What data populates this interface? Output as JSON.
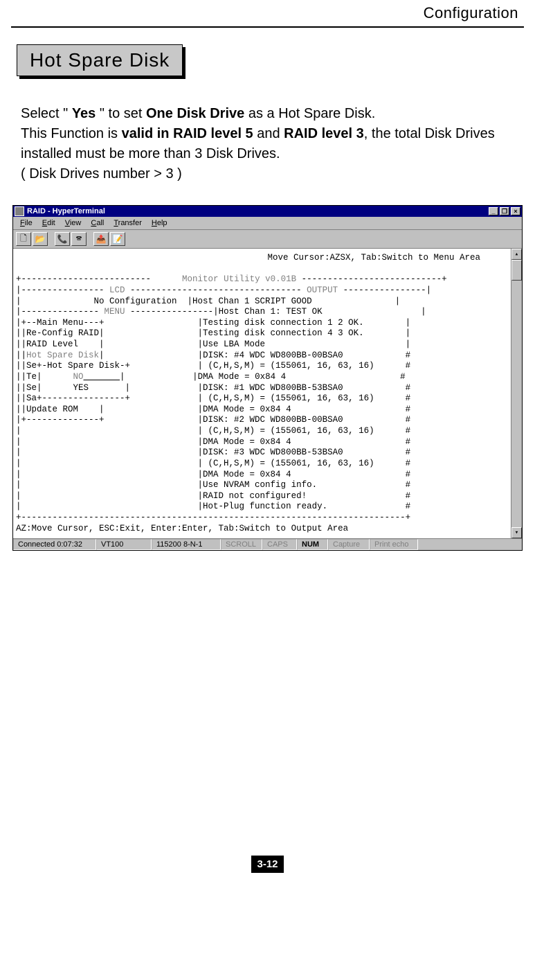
{
  "doc": {
    "header": "Configuration",
    "section_title": "Hot Spare Disk",
    "page_number": "3-12"
  },
  "body": {
    "p1_a": "Select \" ",
    "p1_yes": "Yes",
    "p1_b": " \" to set ",
    "p1_odd": "One Disk Drive",
    "p1_c": " as a Hot Spare Disk.",
    "p2_a": "This Function is ",
    "p2_v5": "valid in RAID level 5",
    "p2_b": " and ",
    "p2_v3": "RAID level 3",
    "p2_c": ", the total Disk Drives installed must be more than 3 Disk Drives.",
    "p3": "( Disk Drives number > 3 )"
  },
  "ht": {
    "title": "RAID - HyperTerminal",
    "menu": {
      "file": "File",
      "edit": "Edit",
      "view": "View",
      "call": "Call",
      "transfer": "Transfer",
      "help": "Help"
    },
    "toolbar_icons": {
      "new": "🗋",
      "open": "📂",
      "connect": "📞",
      "disconnect": "🕿",
      "send": "📤",
      "properties": "📝"
    },
    "winbtns": {
      "min": "_",
      "max": "❐",
      "close": "×"
    },
    "scroll": {
      "up": "▴",
      "down": "▾"
    },
    "status": {
      "connected": "Connected 0:07:32",
      "emulation": "VT100",
      "settings": "115200 8-N-1",
      "scroll": "SCROLL",
      "caps": "CAPS",
      "num": "NUM",
      "capture": "Capture",
      "print": "Print echo"
    },
    "term": {
      "hint": "Move Cursor:AZSX, Tab:Switch to Menu Area",
      "l01": "+-------------------------",
      "l01g": "      Monitor Utility v0.01B ",
      "l01b": "---------------------------+",
      "l02a": "|---------------- ",
      "l02g": "LCD",
      "l02b": " --------------------------------- ",
      "l02g2": "OUTPUT",
      "l02c": " ----------------|",
      "l03": "|              No Configuration  |Host Chan 1 SCRIPT GOOD                |",
      "l04a": "|--------------- ",
      "l04g": "MENU",
      "l04b": " ----------------|Host Chan 1: TEST OK                   |",
      "l05": "|+--Main Menu---+                  |Testing disk connection 1 2 OK.        |",
      "l06": "||Re-Config RAID|                  |Testing disk connection 4 3 OK.        |",
      "l07": "||RAID Level    |                  |Use LBA Mode                           |",
      "l08a": "||",
      "l08g": "Hot Spare Disk",
      "l08b": "|                  |DISK: #4 WDC WD800BB-00BSA0            #",
      "l09": "||Se+-Hot Spare Disk-+             | (C,H,S,M) = (155061, 16, 63, 16)      #",
      "l10a": "||Te|      ",
      "l10g": "NO",
      "l10u": "       ",
      "l10b": "|             |DMA Mode = 0x84 4                      #",
      "l11": "||Se|      YES       |             |DISK: #1 WDC WD800BB-53BSA0            #",
      "l12": "||Sa+----------------+             | (C,H,S,M) = (155061, 16, 63, 16)      #",
      "l13": "||Update ROM    |                  |DMA Mode = 0x84 4                      #",
      "l14": "|+--------------+                  |DISK: #2 WDC WD800BB-00BSA0            #",
      "l15": "|                                  | (C,H,S,M) = (155061, 16, 63, 16)      #",
      "l16": "|                                  |DMA Mode = 0x84 4                      #",
      "l17": "|                                  |DISK: #3 WDC WD800BB-53BSA0            #",
      "l18": "|                                  | (C,H,S,M) = (155061, 16, 63, 16)      #",
      "l19": "|                                  |DMA Mode = 0x84 4                      #",
      "l20": "|                                  |Use NVRAM config info.                 #",
      "l21": "|                                  |RAID not configured!                   #",
      "l22": "|                                  |Hot-Plug function ready.               #",
      "l23": "+--------------------------------------------------------------------------+",
      "l24": "AZ:Move Cursor, ESC:Exit, Enter:Enter, Tab:Switch to Output Area"
    }
  }
}
